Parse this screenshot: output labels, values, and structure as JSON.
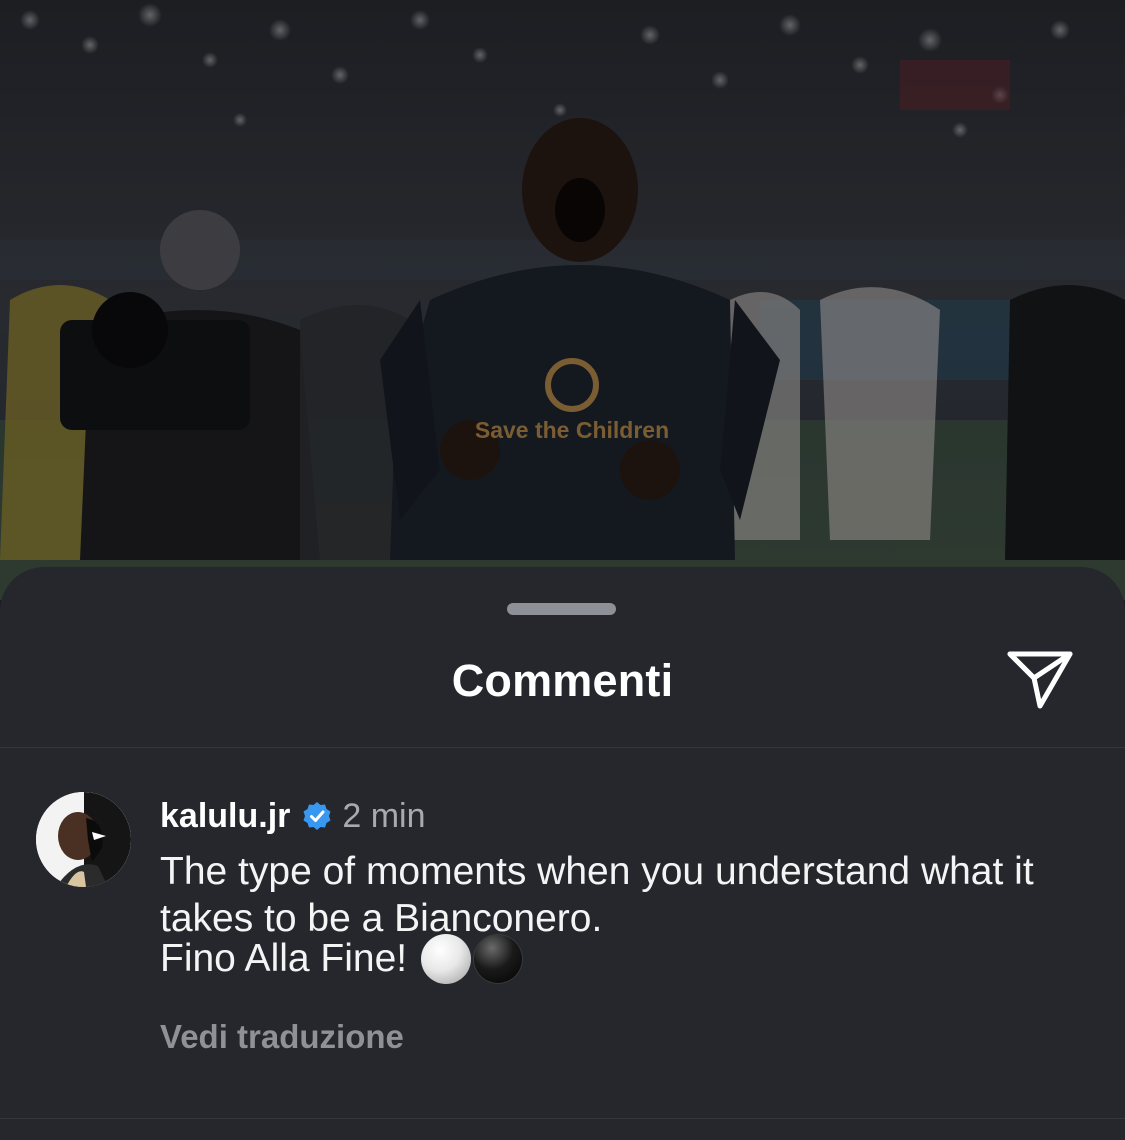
{
  "background_photo": {
    "icon": "celebration-photo",
    "jersey_text": "Save the Children"
  },
  "sheet": {
    "title": "Commenti",
    "share_icon": "send-icon"
  },
  "comment": {
    "avatar_icon": "user-avatar",
    "username": "kalulu.jr",
    "verified_icon": "verified-badge-icon",
    "timestamp": "2 min",
    "text": "The type of moments when you understand what it takes to be a Bianconero.",
    "text_line2": "Fino Alla Fine!",
    "emoji_1": "white-circle-emoji",
    "emoji_2": "black-circle-emoji",
    "translate_label": "Vedi traduzione"
  },
  "colors": {
    "sheet_bg": "#25272c",
    "verified_blue": "#3897f0",
    "muted_text": "#8f9198"
  }
}
